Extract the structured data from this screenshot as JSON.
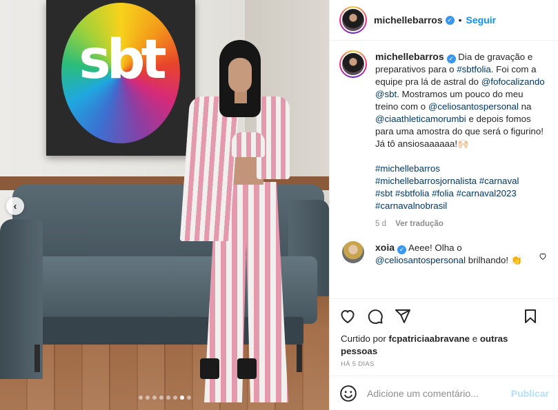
{
  "header": {
    "username": "michellebarros",
    "separator": "•",
    "follow_label": "Seguir",
    "more_label": "···"
  },
  "photo": {
    "logo_text": "sbt",
    "prev_label": "‹",
    "carousel_dots": 8,
    "carousel_active": 6
  },
  "caption": {
    "username": "michellebarros",
    "text_1": " Dia de gravação e preparativos para o ",
    "link_1": "#sbtfolia",
    "text_2": ". Foi com a equipe pra lá de astral do ",
    "link_2": "@fofocalizando",
    "text_3": " ",
    "link_3": "@sbt",
    "text_4": ". Mostramos um pouco do meu treino com o ",
    "link_4": "@celiosantospersonal",
    "text_5": " na ",
    "link_5": "@ciaathleticamorumbi",
    "text_6": " e depois fomos para uma amostra do que será o figurino!",
    "line_2": "Já tô ansiosaaaaaa!🙌🏻",
    "hashtags": [
      "#michellebarros",
      "#michellebarrosjornalista",
      "#carnaval",
      "#sbt",
      "#sbtfolia",
      "#folia",
      "#carnaval2023",
      "#carnavalnobrasil"
    ],
    "age": "5 d",
    "translate_label": "Ver tradução"
  },
  "comment": {
    "username": "xoia",
    "text_1": " Aeee! Olha o ",
    "mention": "@celiosantospersonal",
    "text_2": " brilhando! 👏"
  },
  "actions": {
    "like_icon": "heart-icon",
    "comment_icon": "comment-icon",
    "share_icon": "share-icon",
    "save_icon": "bookmark-icon"
  },
  "likes": {
    "prefix": "Curtido por ",
    "user": "fcpatriciaabravane",
    "middle": " e ",
    "others": "outras pessoas"
  },
  "date": "HÁ 5 DIAS",
  "comment_box": {
    "placeholder": "Adicione um comentário...",
    "publish_label": "Publicar"
  },
  "colors": {
    "link": "#00376b",
    "follow": "#0095f6",
    "publish_disabled": "#b2dffc",
    "verified": "#3897f0"
  }
}
